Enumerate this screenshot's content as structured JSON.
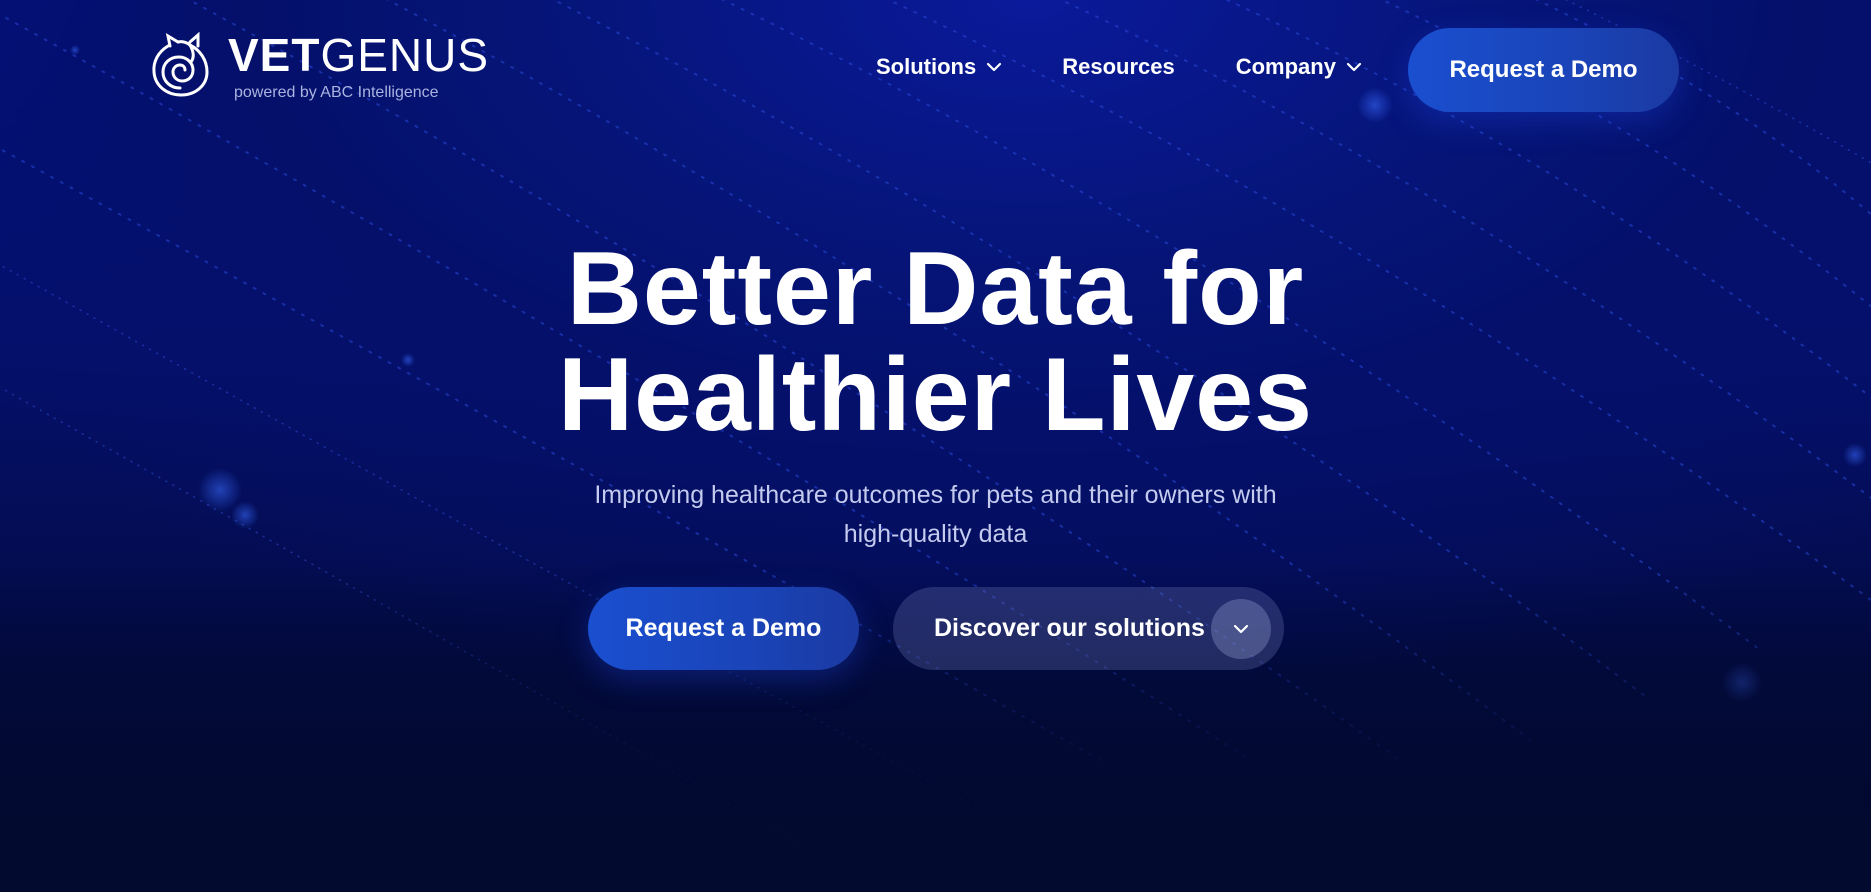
{
  "brand": {
    "name_bold": "VET",
    "name_light": "GENUS",
    "tagline": "powered by ABC Intelligence",
    "logo_icon": "cat-spiral-icon"
  },
  "nav": {
    "items": [
      {
        "label": "Solutions",
        "has_dropdown": true
      },
      {
        "label": "Resources",
        "has_dropdown": false
      },
      {
        "label": "Company",
        "has_dropdown": true
      }
    ],
    "cta_label": "Request a Demo"
  },
  "hero": {
    "title_line1": "Better Data for",
    "title_line2": "Healthier Lives",
    "subtitle_line1": "Improving healthcare outcomes for pets and their owners with",
    "subtitle_line2": "high-quality data",
    "primary_cta": "Request a Demo",
    "secondary_cta": "Discover our solutions",
    "secondary_icon": "chevron-down-icon"
  },
  "colors": {
    "background": "#04106a",
    "accent": "#1a4fd0",
    "text": "#ffffff",
    "muted_text": "#c4cbef"
  }
}
